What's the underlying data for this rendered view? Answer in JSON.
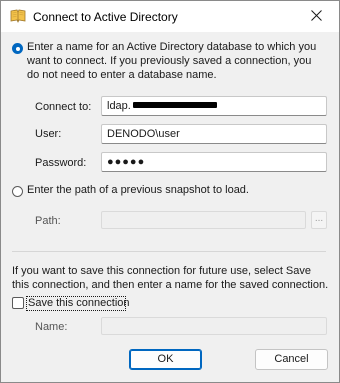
{
  "window": {
    "title": "Connect to Active Directory"
  },
  "option_database": {
    "text": "Enter a name for an Active Directory database to which you want to connect. If you previously saved a connection, you do not need to enter a database name.",
    "line1": "Enter a name for an Active Directory database to which you",
    "line2": "want to connect. If you previously saved a connection, you",
    "line3": "do not need to enter a database name.",
    "checked": true
  },
  "connect_to": {
    "label": "Connect to:",
    "value": "ldap."
  },
  "user": {
    "label": "User:",
    "value": "DENODO\\user"
  },
  "password": {
    "label": "Password:",
    "value": "●●●●●"
  },
  "option_snapshot": {
    "text": "Enter the path of a previous snapshot to load.",
    "checked": false
  },
  "path": {
    "label": "Path:",
    "value": "",
    "browse_label": "..."
  },
  "save_info": {
    "line1": "If you want to save this connection for future use, select Save",
    "line2": "this connection, and then enter a name for the saved connection."
  },
  "save_connection": {
    "label": "Save this connection",
    "checked": false
  },
  "name": {
    "label": "Name:",
    "value": ""
  },
  "buttons": {
    "ok": "OK",
    "cancel": "Cancel"
  },
  "colors": {
    "accent": "#0067c0"
  },
  "icons": {
    "app": "book-icon",
    "close": "close-icon"
  }
}
